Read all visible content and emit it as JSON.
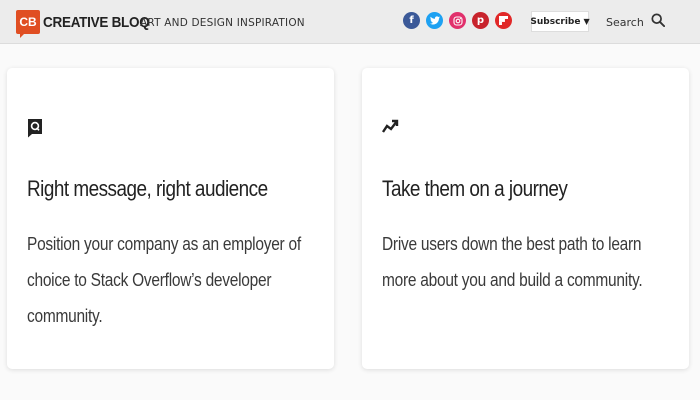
{
  "header": {
    "logo_badge": "CB",
    "logo_text": "CREATIVE BLOQ",
    "tagline": "ART AND DESIGN INSPIRATION",
    "social": [
      {
        "icon": "facebook-icon",
        "glyph": "f",
        "color": "#3b5998"
      },
      {
        "icon": "twitter-icon",
        "glyph": "",
        "color": "#1da1f2"
      },
      {
        "icon": "instagram-icon",
        "glyph": "",
        "color": "#e1306c"
      },
      {
        "icon": "pinterest-icon",
        "glyph": "p",
        "color": "#c8232c"
      },
      {
        "icon": "flipboard-icon",
        "glyph": "",
        "color": "#e12828"
      }
    ],
    "subscribe_label": "Subscribe",
    "subscribe_caret": "▼",
    "search_label": "Search"
  },
  "cards": [
    {
      "icon": "chat-q-icon",
      "title": "Right message, right audience",
      "description": "Position your company as an employer of choice to Stack Overflow’s developer community."
    },
    {
      "icon": "trending-up-icon",
      "title": "Take them on a journey",
      "description": "Drive users down the best path to learn more about you and build a community."
    }
  ],
  "colors": {
    "brand": "#e04e22",
    "header_bg": "#ececec",
    "page_bg": "#fafafa"
  }
}
